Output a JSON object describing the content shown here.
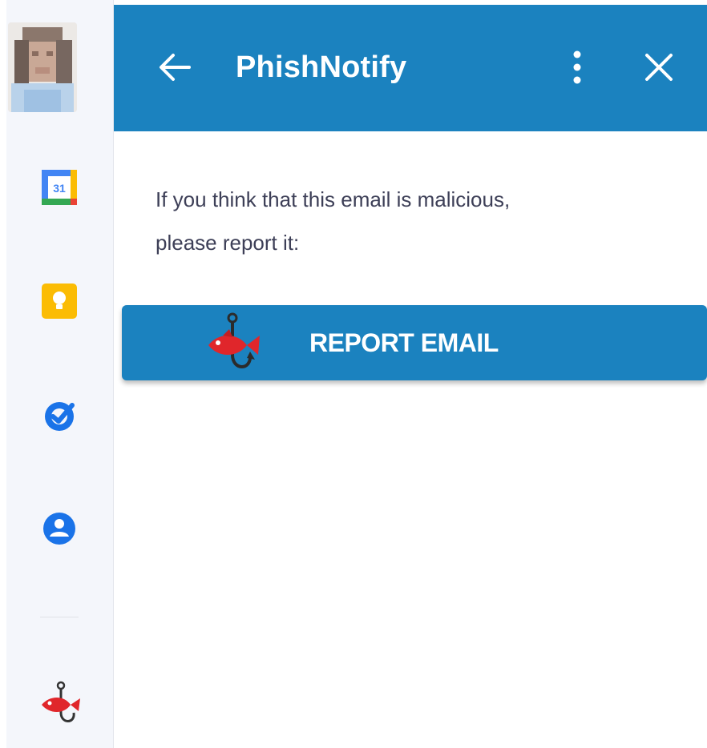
{
  "header": {
    "title": "PhishNotify",
    "back_icon": "arrow-left-icon",
    "more_icon": "more-vertical-icon",
    "close_icon": "close-icon"
  },
  "body": {
    "message_line1": "If you think that this email is malicious,",
    "message_line2": "please report it:",
    "report_button_label": "REPORT EMAIL",
    "report_button_icon": "phish-hook-icon"
  },
  "sidebar": {
    "items": [
      {
        "icon": "avatar"
      },
      {
        "icon": "calendar-icon",
        "label": "31"
      },
      {
        "icon": "keep-icon"
      },
      {
        "icon": "tasks-icon"
      },
      {
        "icon": "contacts-icon"
      },
      {
        "icon": "phish-hook-icon"
      }
    ]
  },
  "colors": {
    "header_bg": "#1b82bf",
    "button_bg": "#1b82bf",
    "text": "#3d3f57",
    "fish_red": "#e0262b"
  }
}
